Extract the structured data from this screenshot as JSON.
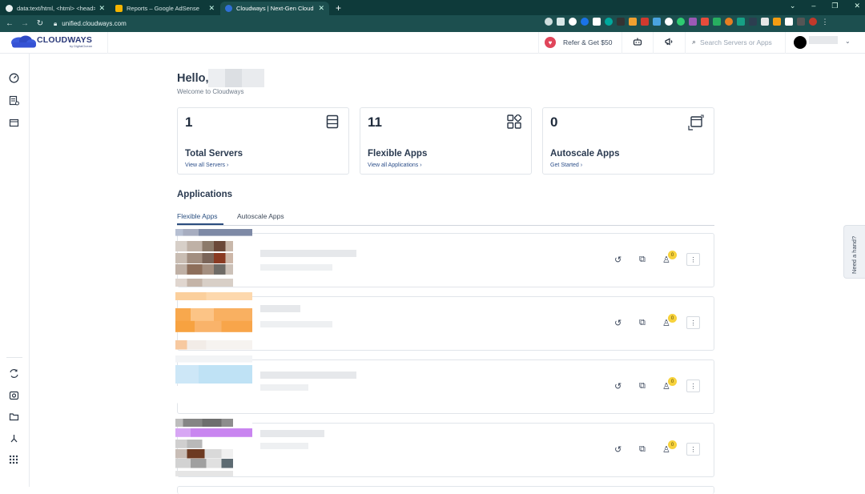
{
  "browser": {
    "tabs": [
      {
        "title": "data:text/html, <html> <head>",
        "color": "#ffffff"
      },
      {
        "title": "Reports – Google AdSense",
        "color": "#f4b400"
      },
      {
        "title": "Cloudways | Next-Gen Cloud Ho",
        "color": "#2f6fd6"
      }
    ],
    "new_tab": "+",
    "url": "unified.cloudways.com",
    "window_controls": [
      "⌄",
      "–",
      "❐",
      "✕"
    ]
  },
  "header": {
    "logo_text": "CLOUDWAYS",
    "logo_sub": "by DigitalOcean",
    "refer_label": "Refer & Get $50",
    "search_placeholder": "Search Servers or Apps"
  },
  "greeting": {
    "hello": "Hello,",
    "welcome": "Welcome to Cloudways"
  },
  "stats": [
    {
      "count": "1",
      "title": "Total Servers",
      "link": "View all Servers ›",
      "icon": "server-icon"
    },
    {
      "count": "11",
      "title": "Flexible Apps",
      "link": "View all Applications ›",
      "icon": "apps-grid-icon"
    },
    {
      "count": "0",
      "title": "Autoscale Apps",
      "link": "Get Started ›",
      "icon": "autoscale-icon"
    }
  ],
  "applications": {
    "heading": "Applications",
    "tabs": [
      "Flexible Apps",
      "Autoscale Apps"
    ],
    "rows": [
      {
        "badge": "0"
      },
      {
        "badge": "0"
      },
      {
        "badge": "0"
      },
      {
        "badge": "0"
      }
    ]
  },
  "help_tab": "Need a hand?",
  "colors": {
    "accent": "#2b4c7e",
    "heart": "#e0455a",
    "badge": "#f7d23c",
    "browser_frame": "#0e3a3a"
  }
}
